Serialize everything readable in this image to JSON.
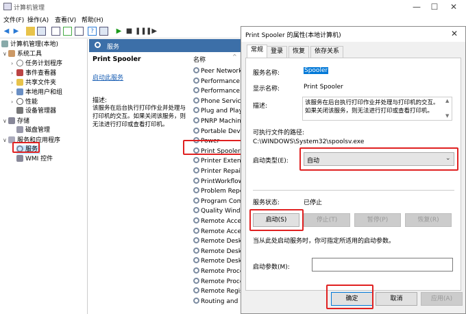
{
  "window": {
    "title": "计算机管理"
  },
  "menu": [
    "文件(F)",
    "操作(A)",
    "查看(V)",
    "帮助(H)"
  ],
  "tree": {
    "root": "计算机管理(本地)",
    "items": [
      {
        "label": "系统工具",
        "level": 0
      },
      {
        "label": "任务计划程序",
        "level": 1
      },
      {
        "label": "事件查看器",
        "level": 1
      },
      {
        "label": "共享文件夹",
        "level": 1
      },
      {
        "label": "本地用户和组",
        "level": 1
      },
      {
        "label": "性能",
        "level": 1
      },
      {
        "label": "设备管理器",
        "level": 1
      },
      {
        "label": "存储",
        "level": 0
      },
      {
        "label": "磁盘管理",
        "level": 1
      },
      {
        "label": "服务和应用程序",
        "level": 0
      },
      {
        "label": "服务",
        "level": 1
      },
      {
        "label": "WMI 控件",
        "level": 1
      }
    ]
  },
  "services_panel": {
    "header": "服务",
    "selected_name": "Print Spooler",
    "start_link": "启动此服务",
    "desc_label": "描述:",
    "desc_text": "该服务在后台执行打印作业并处理与打印机的交互。如果关闭该服务，则无法进行打印或查看打印机。",
    "col_name": "名称",
    "list": [
      "Peer Network",
      "Performance C",
      "Performance L",
      "Phone Service",
      "Plug and Play",
      "PNRP Machine",
      "Portable Devic",
      "Power",
      "Print Spooler",
      "Printer Extensi",
      "Printer Repair",
      "PrintWorkflow",
      "Problem Repo",
      "Program Com",
      "Quality Windo",
      "Remote Acces",
      "Remote Acces",
      "Remote Deskt",
      "Remote Deskt",
      "Remote Deskt",
      "Remote Proce",
      "Remote Proce",
      "Remote Regis",
      "Routing and R"
    ]
  },
  "dialog": {
    "title": "Print Spooler 的属性(本地计算机)",
    "tabs": [
      "常规",
      "登录",
      "恢复",
      "依存关系"
    ],
    "service_name_label": "服务名称:",
    "service_name": "Spooler",
    "display_name_label": "显示名称:",
    "display_name": "Print Spooler",
    "desc_label": "描述:",
    "desc": "该服务在后台执行打印作业并处理与打印机的交互。如果关闭该服务，则无法进行打印或查看打印机。",
    "path_label": "可执行文件的路径:",
    "path": "C:\\WINDOWS\\System32\\spoolsv.exe",
    "startup_label": "启动类型(E):",
    "startup_value": "自动",
    "status_label": "服务状态:",
    "status_value": "已停止",
    "btn_start": "启动(S)",
    "btn_stop": "停止(T)",
    "btn_pause": "暂停(P)",
    "btn_resume": "恢复(R)",
    "hint": "当从此处启动服务时，你可指定所适用的启动参数。",
    "params_label": "启动参数(M):",
    "params_value": "",
    "ok": "确定",
    "cancel": "取消",
    "apply": "应用(A)"
  },
  "colors": {
    "accent": "#3c6fa8",
    "highlight": "#cce8ff",
    "red": "#e02020"
  }
}
